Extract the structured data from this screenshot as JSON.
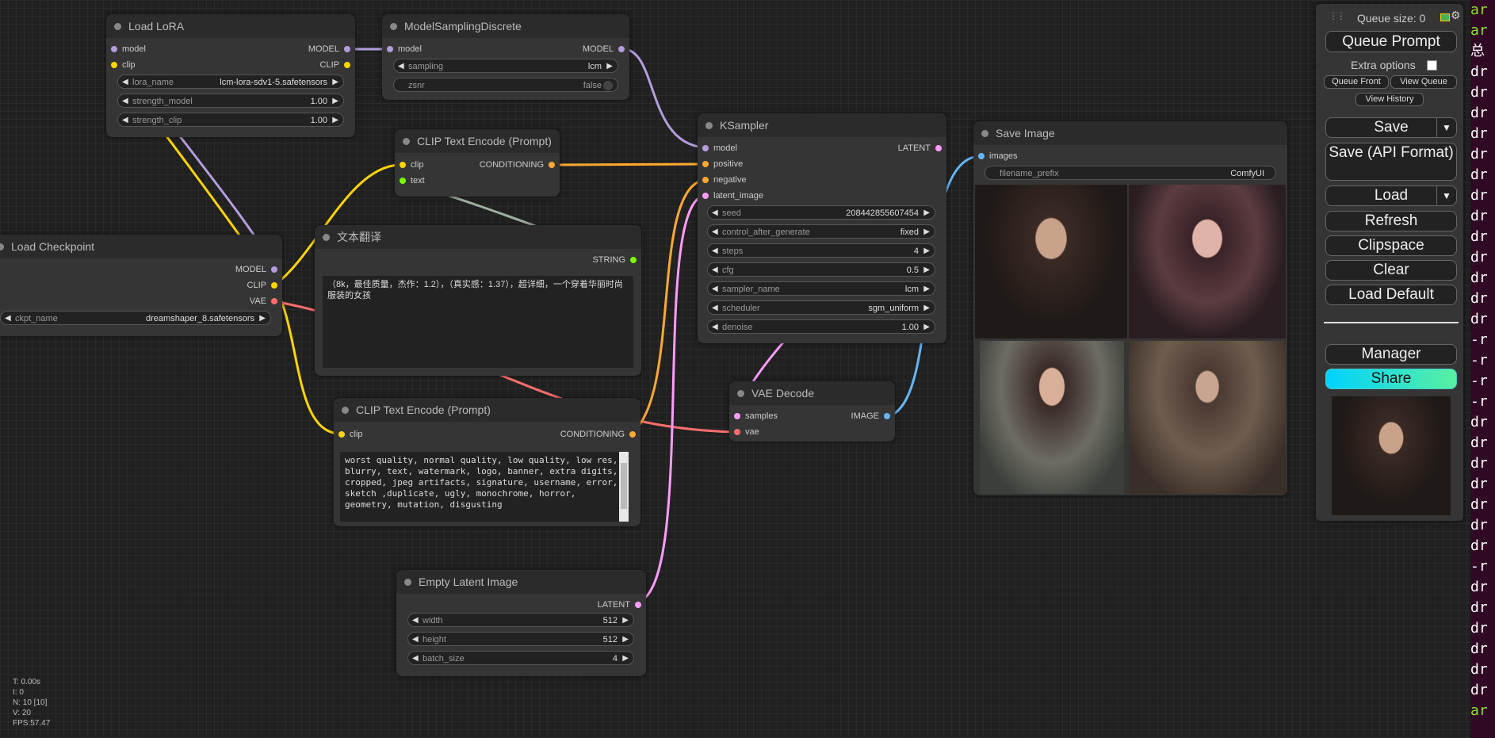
{
  "colors": {
    "model": "#b39ddb",
    "clip": "#ffd500",
    "vae": "#ff6e6e",
    "conditioning": "#ffa931",
    "latent": "#ff9cf9",
    "image": "#64b5f6",
    "string": "#7cfc00",
    "text": "#7cfc00"
  },
  "nodes": {
    "load_lora": {
      "title": "Load LoRA",
      "inputs": [
        "model",
        "clip"
      ],
      "outputs": [
        "MODEL",
        "CLIP"
      ],
      "widgets": [
        {
          "label": "lora_name",
          "value": "lcm-lora-sdv1-5.safetensors"
        },
        {
          "label": "strength_model",
          "value": "1.00"
        },
        {
          "label": "strength_clip",
          "value": "1.00"
        }
      ]
    },
    "model_sampling": {
      "title": "ModelSamplingDiscrete",
      "inputs": [
        "model"
      ],
      "outputs": [
        "MODEL"
      ],
      "widgets": [
        {
          "label": "sampling",
          "value": "lcm"
        },
        {
          "label": "zsnr",
          "value": "false"
        }
      ]
    },
    "clip_encode_pos": {
      "title": "CLIP Text Encode (Prompt)",
      "inputs": [
        "clip",
        "text"
      ],
      "outputs": [
        "CONDITIONING"
      ]
    },
    "load_checkpoint": {
      "title": "Load Checkpoint",
      "outputs": [
        "MODEL",
        "CLIP",
        "VAE"
      ],
      "widgets": [
        {
          "label": "ckpt_name",
          "value": "dreamshaper_8.safetensors"
        }
      ]
    },
    "translate": {
      "title": "文本翻译",
      "outputs": [
        "STRING"
      ],
      "text": "（8k，最佳质量，杰作：1.2），（真实感：1.37），超详细，一个穿着华丽时尚服装的女孩"
    },
    "clip_encode_neg": {
      "title": "CLIP Text Encode (Prompt)",
      "inputs": [
        "clip"
      ],
      "outputs": [
        "CONDITIONING"
      ],
      "text": "worst quality, normal quality, low quality, low res, blurry, text, watermark, logo, banner, extra digits, cropped, jpeg artifacts, signature, username, error, sketch ,duplicate, ugly, monochrome, horror, geometry, mutation, disgusting"
    },
    "ksampler": {
      "title": "KSampler",
      "inputs": [
        "model",
        "positive",
        "negative",
        "latent_image"
      ],
      "outputs": [
        "LATENT"
      ],
      "widgets": [
        {
          "label": "seed",
          "value": "208442855607454"
        },
        {
          "label": "control_after_generate",
          "value": "fixed"
        },
        {
          "label": "steps",
          "value": "4"
        },
        {
          "label": "cfg",
          "value": "0.5"
        },
        {
          "label": "sampler_name",
          "value": "lcm"
        },
        {
          "label": "scheduler",
          "value": "sgm_uniform"
        },
        {
          "label": "denoise",
          "value": "1.00"
        }
      ]
    },
    "vae_decode": {
      "title": "VAE Decode",
      "inputs": [
        "samples",
        "vae"
      ],
      "outputs": [
        "IMAGE"
      ]
    },
    "save_image": {
      "title": "Save Image",
      "inputs": [
        "images"
      ],
      "widgets": [
        {
          "label": "filename_prefix",
          "value": "ComfyUI"
        }
      ]
    },
    "empty_latent": {
      "title": "Empty Latent Image",
      "outputs": [
        "LATENT"
      ],
      "widgets": [
        {
          "label": "width",
          "value": "512"
        },
        {
          "label": "height",
          "value": "512"
        },
        {
          "label": "batch_size",
          "value": "4"
        }
      ]
    }
  },
  "menu": {
    "queue_size": "Queue size: 0",
    "queue_prompt": "Queue Prompt",
    "extra_options": "Extra options",
    "queue_front": "Queue Front",
    "view_queue": "View Queue",
    "view_history": "View History",
    "save": "Save",
    "save_api": "Save (API Format)",
    "load": "Load",
    "refresh": "Refresh",
    "clipspace": "Clipspace",
    "clear": "Clear",
    "load_default": "Load Default",
    "manager": "Manager",
    "share": "Share"
  },
  "stats": [
    "T: 0.00s",
    "I: 0",
    "N: 10 [10]",
    "V: 20",
    "FPS:57.47"
  ],
  "terminal_lines": [
    {
      "text": "ar",
      "color": "#8ae234"
    },
    {
      "text": "ar",
      "color": "#8ae234"
    },
    {
      "text": "总",
      "color": "#ffffff"
    },
    {
      "text": "dr",
      "color": "#ffffff"
    },
    {
      "text": "dr",
      "color": "#ffffff"
    },
    {
      "text": "dr",
      "color": "#ffffff"
    },
    {
      "text": "dr",
      "color": "#ffffff"
    },
    {
      "text": "dr",
      "color": "#ffffff"
    },
    {
      "text": "dr",
      "color": "#ffffff"
    },
    {
      "text": "dr",
      "color": "#ffffff"
    },
    {
      "text": "dr",
      "color": "#ffffff"
    },
    {
      "text": "dr",
      "color": "#ffffff"
    },
    {
      "text": "dr",
      "color": "#ffffff"
    },
    {
      "text": "dr",
      "color": "#ffffff"
    },
    {
      "text": "dr",
      "color": "#ffffff"
    },
    {
      "text": "dr",
      "color": "#ffffff"
    },
    {
      "text": "-r",
      "color": "#ffffff"
    },
    {
      "text": "-r",
      "color": "#ffffff"
    },
    {
      "text": "-r",
      "color": "#ffffff"
    },
    {
      "text": "-r",
      "color": "#ffffff"
    },
    {
      "text": "dr",
      "color": "#ffffff"
    },
    {
      "text": "dr",
      "color": "#ffffff"
    },
    {
      "text": "dr",
      "color": "#ffffff"
    },
    {
      "text": "dr",
      "color": "#ffffff"
    },
    {
      "text": "dr",
      "color": "#ffffff"
    },
    {
      "text": "dr",
      "color": "#ffffff"
    },
    {
      "text": "dr",
      "color": "#ffffff"
    },
    {
      "text": "-r",
      "color": "#ffffff"
    },
    {
      "text": "dr",
      "color": "#ffffff"
    },
    {
      "text": "dr",
      "color": "#ffffff"
    },
    {
      "text": "dr",
      "color": "#ffffff"
    },
    {
      "text": "dr",
      "color": "#ffffff"
    },
    {
      "text": "dr",
      "color": "#ffffff"
    },
    {
      "text": "dr",
      "color": "#ffffff"
    },
    {
      "text": "ar",
      "color": "#8ae234"
    }
  ]
}
